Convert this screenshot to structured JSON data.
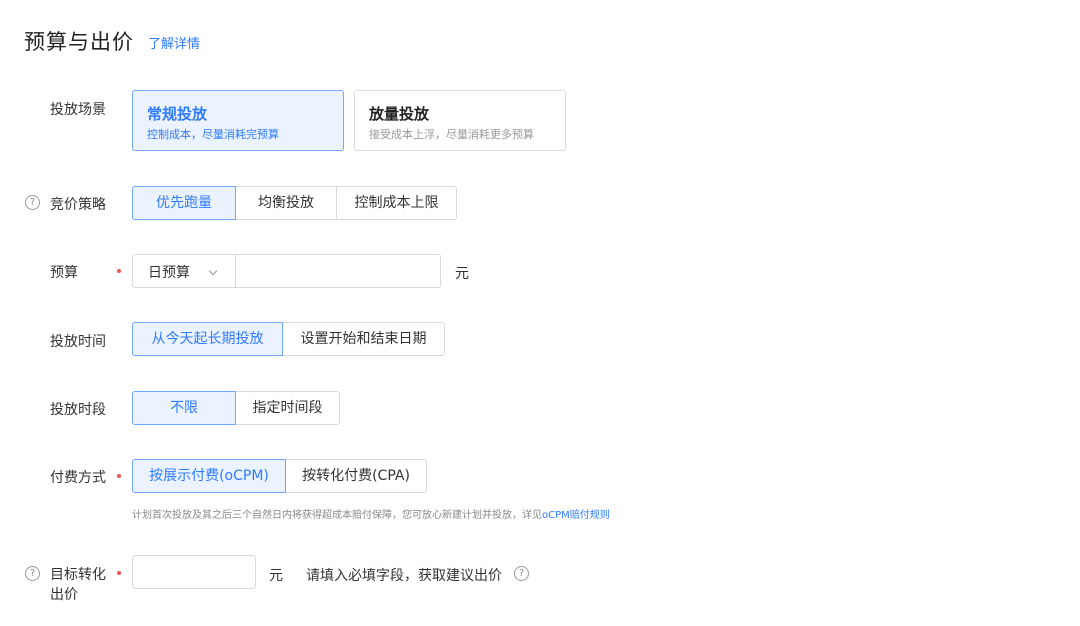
{
  "section": {
    "title": "预算与出价",
    "learn_more": "了解详情"
  },
  "scene": {
    "label": "投放场景",
    "options": [
      {
        "title": "常规投放",
        "desc": "控制成本，尽量消耗完预算",
        "selected": true
      },
      {
        "title": "放量投放",
        "desc": "接受成本上浮，尽量消耗更多预算",
        "selected": false
      }
    ]
  },
  "strategy": {
    "help_icon": "?",
    "label": "竞价策略",
    "options": [
      "优先跑量",
      "均衡投放",
      "控制成本上限"
    ],
    "selected": "优先跑量"
  },
  "budget": {
    "label": "预算",
    "type_value": "日预算",
    "amount_value": "",
    "unit": "元"
  },
  "schedule": {
    "label": "投放时间",
    "options": [
      "从今天起长期投放",
      "设置开始和结束日期"
    ],
    "selected": "从今天起长期投放"
  },
  "period": {
    "label": "投放时段",
    "options": [
      "不限",
      "指定时间段"
    ],
    "selected": "不限"
  },
  "payment": {
    "label": "付费方式",
    "options": [
      "按展示付费(oCPM)",
      "按转化付费(CPA)"
    ],
    "selected": "按展示付费(oCPM)",
    "note": "计划首次投放及其之后三个自然日内将获得超成本赔付保障，您可放心新建计划并投放，详见",
    "note_link": "oCPM赔付规则"
  },
  "bid": {
    "help_icon": "?",
    "label_line1": "目标转化",
    "label_line2": "出价",
    "value": "",
    "unit": "元",
    "hint": "请填入必填字段，获取建议出价",
    "hint_help_icon": "?"
  },
  "colors": {
    "accent": "#2f7bff",
    "active_bg": "#eaf3ff",
    "required": "#f5544f"
  }
}
